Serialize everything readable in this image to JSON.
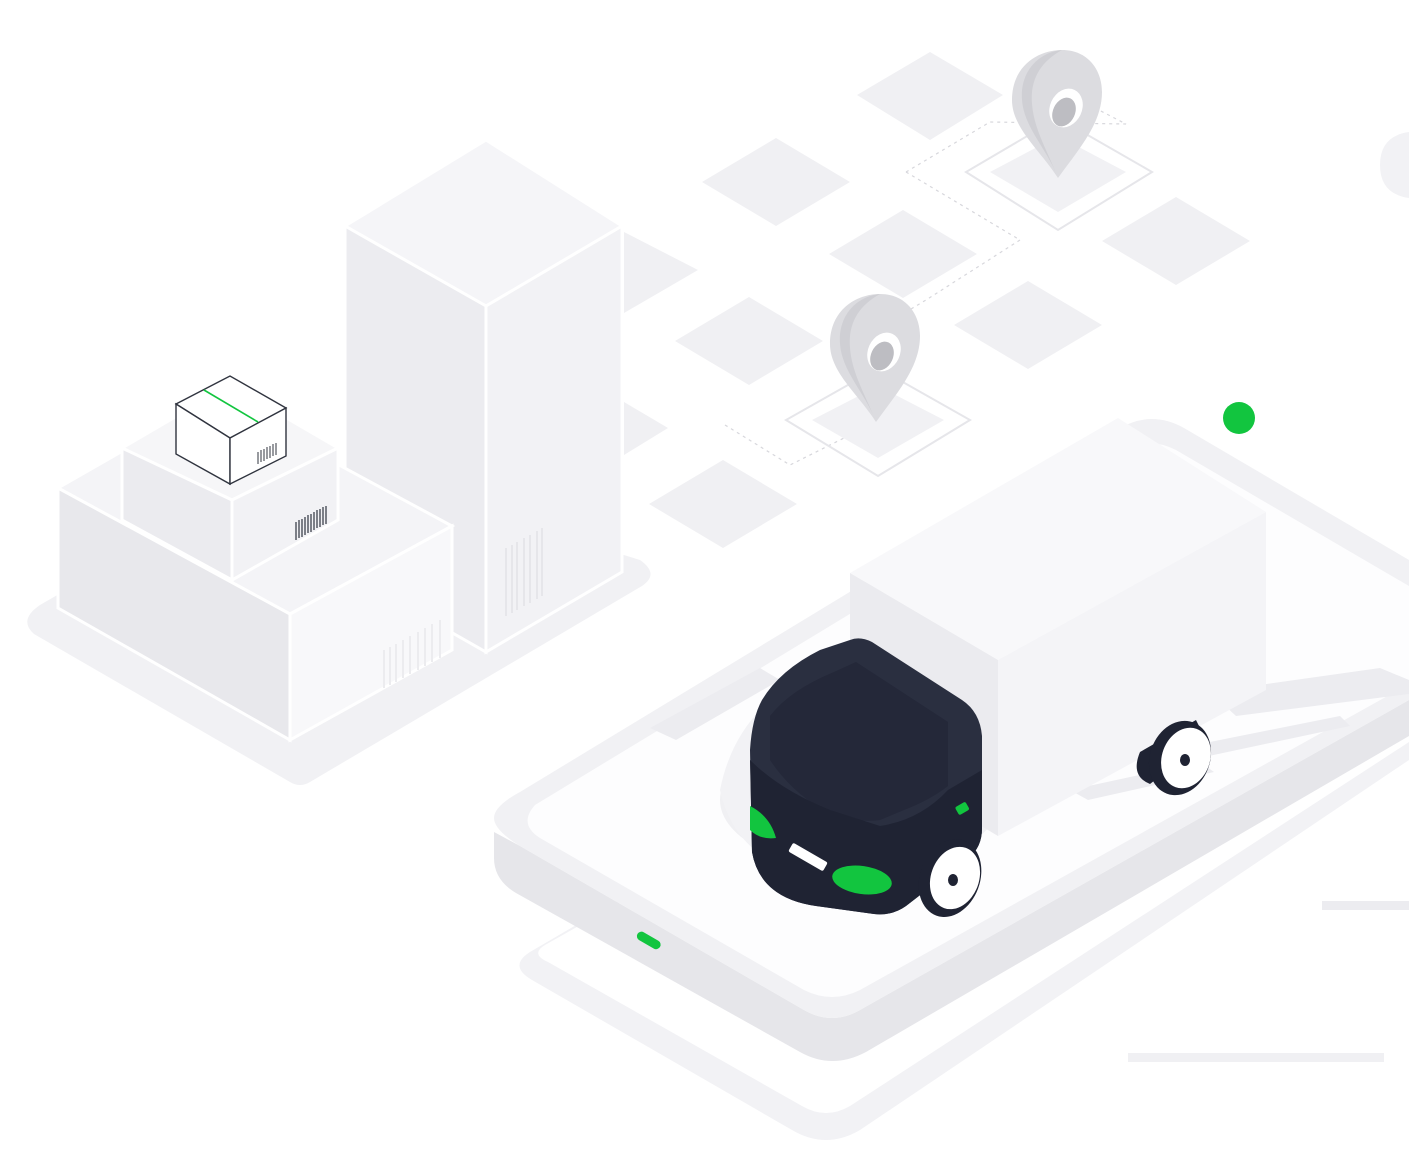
{
  "illustration": {
    "subject": "delivery-logistics",
    "colors": {
      "background": "#ffffff",
      "tile": "#f0f0f3",
      "outline": "#e4e4e8",
      "light_face": "#f4f4f7",
      "mid_face": "#e7e7eb",
      "dark_face": "#dcdce1",
      "truck_cab": "#2a2f40",
      "truck_cab_dark": "#1f2333",
      "accent_green": "#12c53f",
      "pin_gray": "#d6d6da",
      "pin_hole": "#bdbdc2",
      "box_stroke": "#30343f"
    },
    "icons": [
      "warehouse-building",
      "stacked-parcels",
      "parcel-box",
      "barcode",
      "location-pin",
      "delivery-truck",
      "smartphone-base",
      "status-dot"
    ]
  }
}
